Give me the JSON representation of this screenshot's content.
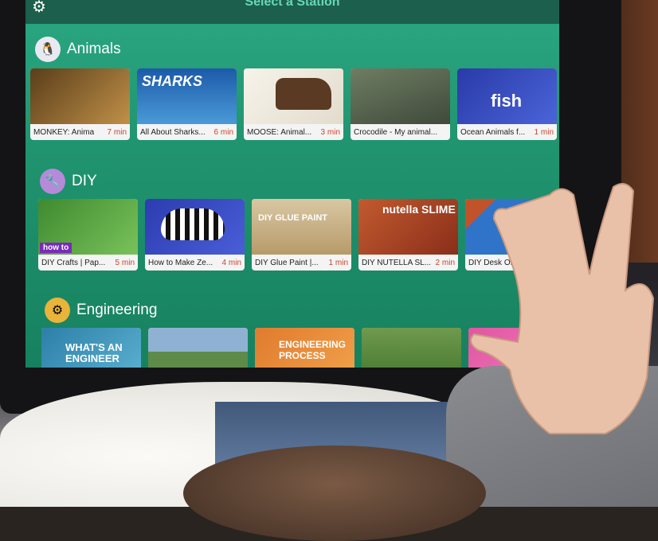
{
  "app": {
    "title": "Select a Station",
    "settings_icon": "gear-icon"
  },
  "sections": [
    {
      "label": "Animals",
      "icon": "penguin-icon",
      "icon_color": "#e9e9f2",
      "cards": [
        {
          "title": "MONKEY: Anima",
          "duration": "7 min",
          "thumb_text": "",
          "thumb_bg": "#8a6a2a"
        },
        {
          "title": "All About Sharks...",
          "duration": "6 min",
          "thumb_text": "SHARKS",
          "thumb_bg": "#2a6fb3"
        },
        {
          "title": "MOOSE: Animal...",
          "duration": "3 min",
          "thumb_text": "",
          "thumb_bg": "#f0ede6"
        },
        {
          "title": "Crocodile - My animal...",
          "duration": "",
          "thumb_text": "",
          "thumb_bg": "#5b6b54"
        },
        {
          "title": "Ocean Animals f...",
          "duration": "1 min",
          "thumb_text": "fish",
          "thumb_bg": "#3b4fb6"
        }
      ]
    },
    {
      "label": "DIY",
      "icon": "tools-icon",
      "icon_color": "#b58ad8",
      "cards": [
        {
          "title": "DIY Crafts | Pap...",
          "duration": "5 min",
          "thumb_text": "how to",
          "thumb_bg": "#4f9a3e"
        },
        {
          "title": "How to Make Ze...",
          "duration": "4 min",
          "thumb_text": "",
          "thumb_bg": "#3a4ab8"
        },
        {
          "title": "DIY Glue Paint |...",
          "duration": "1 min",
          "thumb_text": "DIY GLUE PAINT",
          "thumb_bg": "#c9b28a"
        },
        {
          "title": "DIY NUTELLA SL...",
          "duration": "2 min",
          "thumb_text": "nutella SLIME",
          "thumb_bg": "#b24a2a"
        },
        {
          "title": "DIY Desk Orga",
          "duration": "",
          "thumb_text": "",
          "thumb_bg": "#2f74c8"
        }
      ]
    },
    {
      "label": "Engineering",
      "icon": "gears-icon",
      "icon_color": "#e8b43a",
      "cards": [
        {
          "title": "",
          "duration": "",
          "thumb_text": "WHAT'S AN ENGINEER",
          "thumb_bg": "#2d7fa8"
        },
        {
          "title": "",
          "duration": "",
          "thumb_text": "",
          "thumb_bg": "#7fa3c2"
        },
        {
          "title": "",
          "duration": "",
          "thumb_text": "ENGINEERING PROCESS",
          "thumb_bg": "#e07b2e"
        },
        {
          "title": "",
          "duration": "",
          "thumb_text": "",
          "thumb_bg": "#5a8c3e"
        },
        {
          "title": "",
          "duration": "",
          "thumb_text": "",
          "thumb_bg": "#e056a0"
        }
      ]
    }
  ],
  "colors": {
    "screen": "#20946f",
    "duration": "#c7462c"
  }
}
